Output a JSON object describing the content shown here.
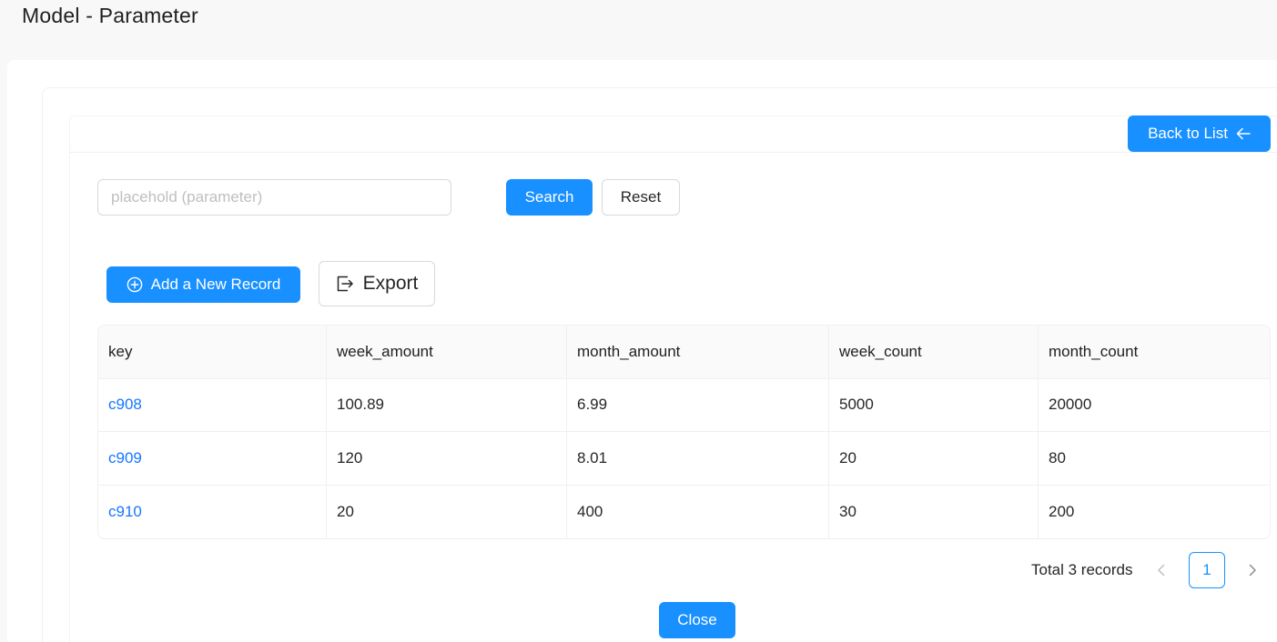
{
  "page": {
    "title": "Model - Parameter"
  },
  "toolbar": {
    "back_label": "Back to List",
    "search_placeholder": "placehold (parameter)",
    "search_value": "",
    "search_label": "Search",
    "reset_label": "Reset",
    "add_label": "Add a New Record",
    "export_label": "Export"
  },
  "table": {
    "headers": [
      "key",
      "week_amount",
      "month_amount",
      "week_count",
      "month_count"
    ],
    "rows": [
      {
        "key": "c908",
        "week_amount": "100.89",
        "month_amount": "6.99",
        "week_count": "5000",
        "month_count": "20000"
      },
      {
        "key": "c909",
        "week_amount": "120",
        "month_amount": "8.01",
        "week_count": "20",
        "month_count": "80"
      },
      {
        "key": "c910",
        "week_amount": "20",
        "month_amount": "400",
        "week_count": "30",
        "month_count": "200"
      }
    ]
  },
  "pagination": {
    "total_text": "Total 3 records",
    "current_page": "1"
  },
  "footer": {
    "close_label": "Close"
  },
  "icons": {
    "back": "arrow-left-icon",
    "add": "plus-circle-icon",
    "export": "export-icon",
    "prev": "chevron-left-icon",
    "next": "chevron-right-icon"
  },
  "colors": {
    "primary": "#1890ff",
    "link": "#1677ff",
    "border": "#d9d9d9"
  }
}
